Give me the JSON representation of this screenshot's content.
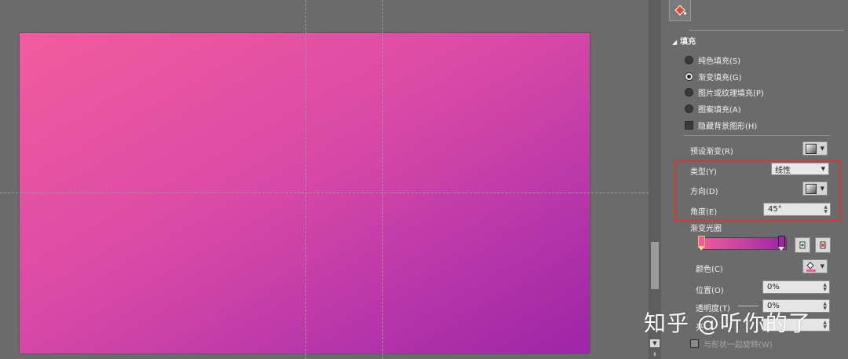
{
  "fill_panel": {
    "section_title": "填充",
    "options": [
      {
        "label": "纯色填充(S)",
        "selected": false
      },
      {
        "label": "渐变填充(G)",
        "selected": true
      },
      {
        "label": "图片或纹理填充(P)",
        "selected": false
      },
      {
        "label": "图案填充(A)",
        "selected": false
      }
    ],
    "hide_background_label": "隐藏背景图形(H)",
    "preset_gradient_label": "预设渐变(R)",
    "type_label": "类型(Y)",
    "type_value": "线性",
    "direction_label": "方向(D)",
    "angle_label": "角度(E)",
    "angle_value": "45°",
    "gradient_stops_label": "渐变光圈",
    "color_label": "颜色(C)",
    "position_label": "位置(O)",
    "position_value": "0%",
    "transparency_label": "透明度(T)",
    "transparency_value": "0%",
    "brightness_label_partial": "亮",
    "rotate_with_shape_label": "与形状一起旋转(W)"
  },
  "watermark": "知乎 @听你的了",
  "colors": {
    "gradient_start": "#f25c9e",
    "gradient_end": "#9c25a8",
    "highlight_box": "#d23a3a",
    "panel_bg": "#6b6b6b"
  },
  "icons": [
    "paint-bucket-icon",
    "scroll-down-icon",
    "add-stop-icon",
    "remove-stop-icon",
    "fill-color-icon"
  ]
}
